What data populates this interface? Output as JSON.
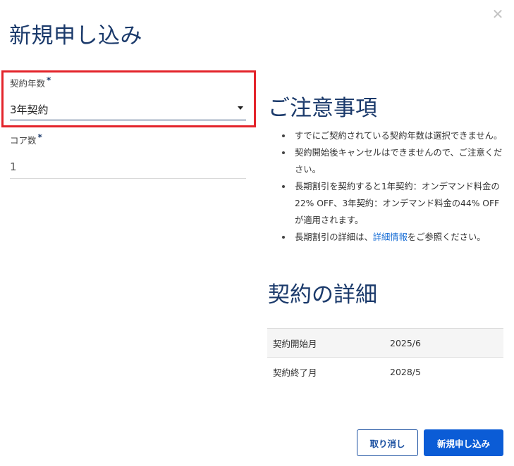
{
  "dialog": {
    "title": "新規申し込み",
    "close_icon": "close-icon"
  },
  "form": {
    "contract_years": {
      "label": "契約年数",
      "required_mark": "*",
      "selected": "3年契約"
    },
    "core_count": {
      "label": "コア数",
      "required_mark": "*",
      "value": "1"
    }
  },
  "notes": {
    "title": "ご注意事項",
    "items": [
      "すでにご契約されている契約年数は選択できません。",
      "契約開始後キャンセルはできませんので、ご注意ください。",
      "長期割引を契約すると1年契約：オンデマンド料金の22% OFF、3年契約：オンデマンド料金の44% OFFが適用されます。"
    ],
    "last_item": {
      "prefix": "長期割引の詳細は、",
      "link_text": "詳細情報",
      "suffix": "をご参照ください。"
    }
  },
  "details": {
    "title": "契約の詳細",
    "rows": [
      {
        "label": "契約開始月",
        "value": "2025/6"
      },
      {
        "label": "契約終了月",
        "value": "2028/5"
      }
    ]
  },
  "buttons": {
    "cancel": "取り消し",
    "submit": "新規申し込み"
  },
  "colors": {
    "heading": "#1b3a6b",
    "primary": "#0b5cd6",
    "link": "#1a6fd6",
    "highlight": "#e3242b"
  }
}
